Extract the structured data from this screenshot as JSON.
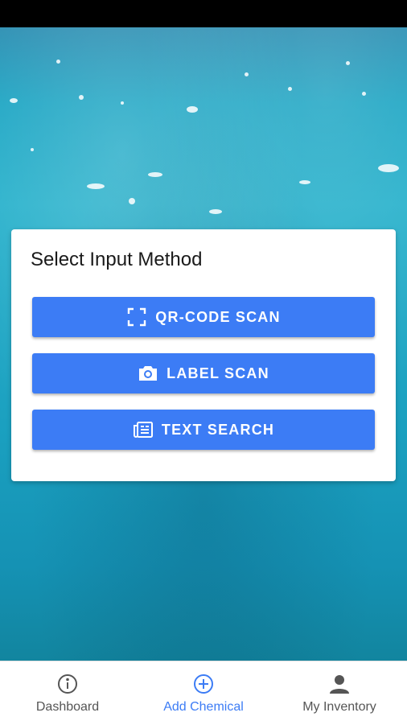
{
  "card": {
    "title": "Select Input Method",
    "buttons": [
      {
        "label": "QR-CODE SCAN",
        "icon": "qr-scan-icon"
      },
      {
        "label": "LABEL SCAN",
        "icon": "camera-icon"
      },
      {
        "label": "TEXT SEARCH",
        "icon": "newspaper-icon"
      }
    ]
  },
  "nav": {
    "items": [
      {
        "label": "Dashboard",
        "icon": "info-icon",
        "active": false
      },
      {
        "label": "Add Chemical",
        "icon": "add-circle-icon",
        "active": true
      },
      {
        "label": "My Inventory",
        "icon": "person-icon",
        "active": false
      }
    ]
  },
  "colors": {
    "accent": "#3c7cf5",
    "nav_inactive": "#555555"
  }
}
